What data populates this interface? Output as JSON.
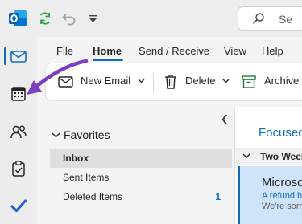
{
  "quick_access": {
    "app_icon": "outlook-icon",
    "sync_icon": "sync-icon",
    "undo_icon": "undo-icon",
    "customize_icon": "customize-dropdown-icon"
  },
  "search": {
    "placeholder": "Se"
  },
  "nav_rail": {
    "items": [
      {
        "name": "mail",
        "icon": "mail-icon",
        "active": true
      },
      {
        "name": "calendar",
        "icon": "calendar-icon",
        "active": false
      },
      {
        "name": "people",
        "icon": "people-icon",
        "active": false
      },
      {
        "name": "tasks",
        "icon": "tasks-icon",
        "active": false
      },
      {
        "name": "todo",
        "icon": "checkmark-icon",
        "active": false
      }
    ]
  },
  "menu": {
    "tabs": [
      {
        "label": "File"
      },
      {
        "label": "Home",
        "active": true
      },
      {
        "label": "Send / Receive"
      },
      {
        "label": "View"
      },
      {
        "label": "Help"
      }
    ]
  },
  "ribbon": {
    "new_email": "New Email",
    "delete": "Delete",
    "archive": "Archive"
  },
  "folders": {
    "favorites_label": "Favorites",
    "items": [
      {
        "label": "Inbox",
        "selected": true,
        "count": ""
      },
      {
        "label": "Sent Items",
        "selected": false,
        "count": ""
      },
      {
        "label": "Deleted Items",
        "selected": false,
        "count": "1"
      }
    ]
  },
  "message_list": {
    "focused_tab": "Focused",
    "group_header": "Two Week",
    "message": {
      "sender": "Microso",
      "subject": "A refund h",
      "preview": "We're sorr"
    }
  },
  "colors": {
    "accent": "#0f6cbd",
    "annotation": "#7b3fbf",
    "selected_row": "#dedede",
    "selected_message": "#cfe4fa"
  }
}
